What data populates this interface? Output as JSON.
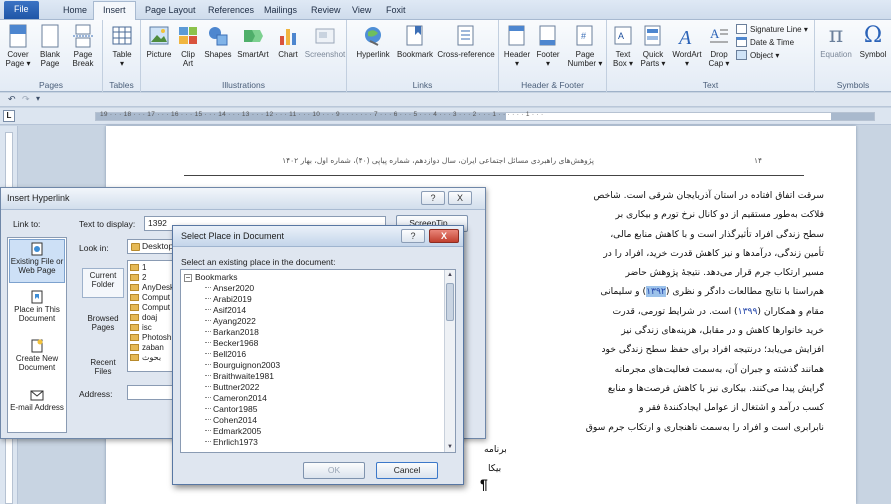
{
  "ribbon_tabs": [
    "File",
    "Home",
    "Insert",
    "Page Layout",
    "References",
    "Mailings",
    "Review",
    "View",
    "Foxit"
  ],
  "ribbon": {
    "pages": {
      "label": "Pages",
      "cover": "Cover\nPage ▾",
      "blank": "Blank\nPage",
      "break": "Page\nBreak"
    },
    "tables": {
      "label": "Tables",
      "table": "Table\n▾"
    },
    "illustrations": {
      "label": "Illustrations",
      "picture": "Picture",
      "clipart": "Clip\nArt",
      "shapes": "Shapes",
      "smartart": "SmartArt",
      "chart": "Chart",
      "screenshot": "Screenshot"
    },
    "links": {
      "label": "Links",
      "hyperlink": "Hyperlink",
      "bookmark": "Bookmark",
      "crossref": "Cross-reference"
    },
    "header_footer": {
      "label": "Header & Footer",
      "header": "Header\n▾",
      "footer": "Footer\n▾",
      "pagenum": "Page\nNumber ▾"
    },
    "text": {
      "label": "Text",
      "textbox": "Text\nBox ▾",
      "quickparts": "Quick\nParts ▾",
      "wordart": "WordArt\n▾",
      "dropcap": "Drop\nCap ▾",
      "sigline": "Signature Line ▾",
      "datetime": "Date & Time",
      "object": "Object ▾"
    },
    "symbols": {
      "label": "Symbols",
      "equation": "Equation",
      "symbol": "Symbol"
    }
  },
  "ruler_numbers": "19 · · · 18 · · · 17 · · · 16 · · · 15 · · · 14 · · · 13 · · · 12 · · · 11 · · · 10 · · · 9 · · · · · · · 7 · · · 6 · · · 5 · · · 4 · · · 3 · · · 2 · · · 1 · · · · · · 1 · · ·",
  "document": {
    "header": "پژوهش‌های راهبردی مسائل اجتماعی ایران، سال دوازدهم، شماره پیاپی (۴۰)، شماره اول، بهار ۱۴۰۲",
    "page_number": "۱۴",
    "lines": [
      "سرقت اتفاق افتاده در استان آذربایجان شرقی است. شاخص",
      "فلاکت به‌طور مستقیم از دو کانال نرخ تورم و بیکاری بر",
      "سطح زندگی افراد تأثیرگذار است و با کاهش منابع مالی،",
      "تأمین زندگی، درآمدها و نیز کاهش قدرت خرید، افراد را در",
      "مسیر ارتکاب جرم قرار می‌دهد. نتیجۀ پژوهش حاضر",
      "هم‌راستا با نتایج مطالعات دادگر و نظری (|۱۳۹۲|) و سلیمانی",
      "مقام و همکاران (|۱۳۹۹|) است. در شرایط تورمی، قدرت",
      "خرید خانوارها کاهش و در مقابل، هزینه‌های زندگی نیز",
      "افزایش می‌یابد؛ درنتیجه افراد برای حفظ سطح زندگی خود",
      "همانند گذشته و جبران آن، به‌سمت فعالیت‌های مجرمانه",
      "گرایش پیدا می‌کنند. بیکاری نیز با کاهش فرصت‌ها و منابع",
      "کسب درآمد و اشتغال از عوامل ایجادکنندۀ فقر و",
      "نابرابری است و افراد را به‌سمت ناهنجاری و ارتکاب جرم سوق"
    ],
    "frag1": "برنامه",
    "frag2": "بیکا"
  },
  "hyperlink_dialog": {
    "title": "Insert Hyperlink",
    "link_to": "Link to:",
    "text_to_display_label": "Text to display:",
    "text_to_display_value": "1392",
    "screentip": "ScreenTip...",
    "look_in_label": "Look in:",
    "look_in_value": "Desktop",
    "link_targets": [
      "Existing File or Web Page",
      "Place in This Document",
      "Create New Document",
      "E-mail Address"
    ],
    "side_buttons": [
      "Current Folder",
      "Browsed Pages",
      "Recent Files"
    ],
    "files": [
      "1",
      "2",
      "AnyDesk",
      "Comput",
      "Comput",
      "doaj",
      "isc",
      "Photosh",
      "zaban",
      "بحوث"
    ],
    "address_label": "Address:",
    "help_glyph": "?",
    "close_glyph": "X"
  },
  "place_dialog": {
    "title": "Select Place in Document",
    "prompt": "Select an existing place in the document:",
    "root": "Bookmarks",
    "bookmarks": [
      "Anser2020",
      "Arabi2019",
      "Asif2014",
      "Ayang2022",
      "Barkan2018",
      "Becker1968",
      "Bell2016",
      "Bourguignon2003",
      "Braithwaite1981",
      "Buttner2022",
      "Cameron2014",
      "Cantor1985",
      "Cohen2014",
      "Edmark2005",
      "Ehrlich1973"
    ],
    "ok": "OK",
    "cancel": "Cancel",
    "help_glyph": "?",
    "close_glyph": "X"
  },
  "colors": {
    "accent": "#2b579a",
    "file_tab": "#2a62b5",
    "selection": "#9cc2ea"
  }
}
